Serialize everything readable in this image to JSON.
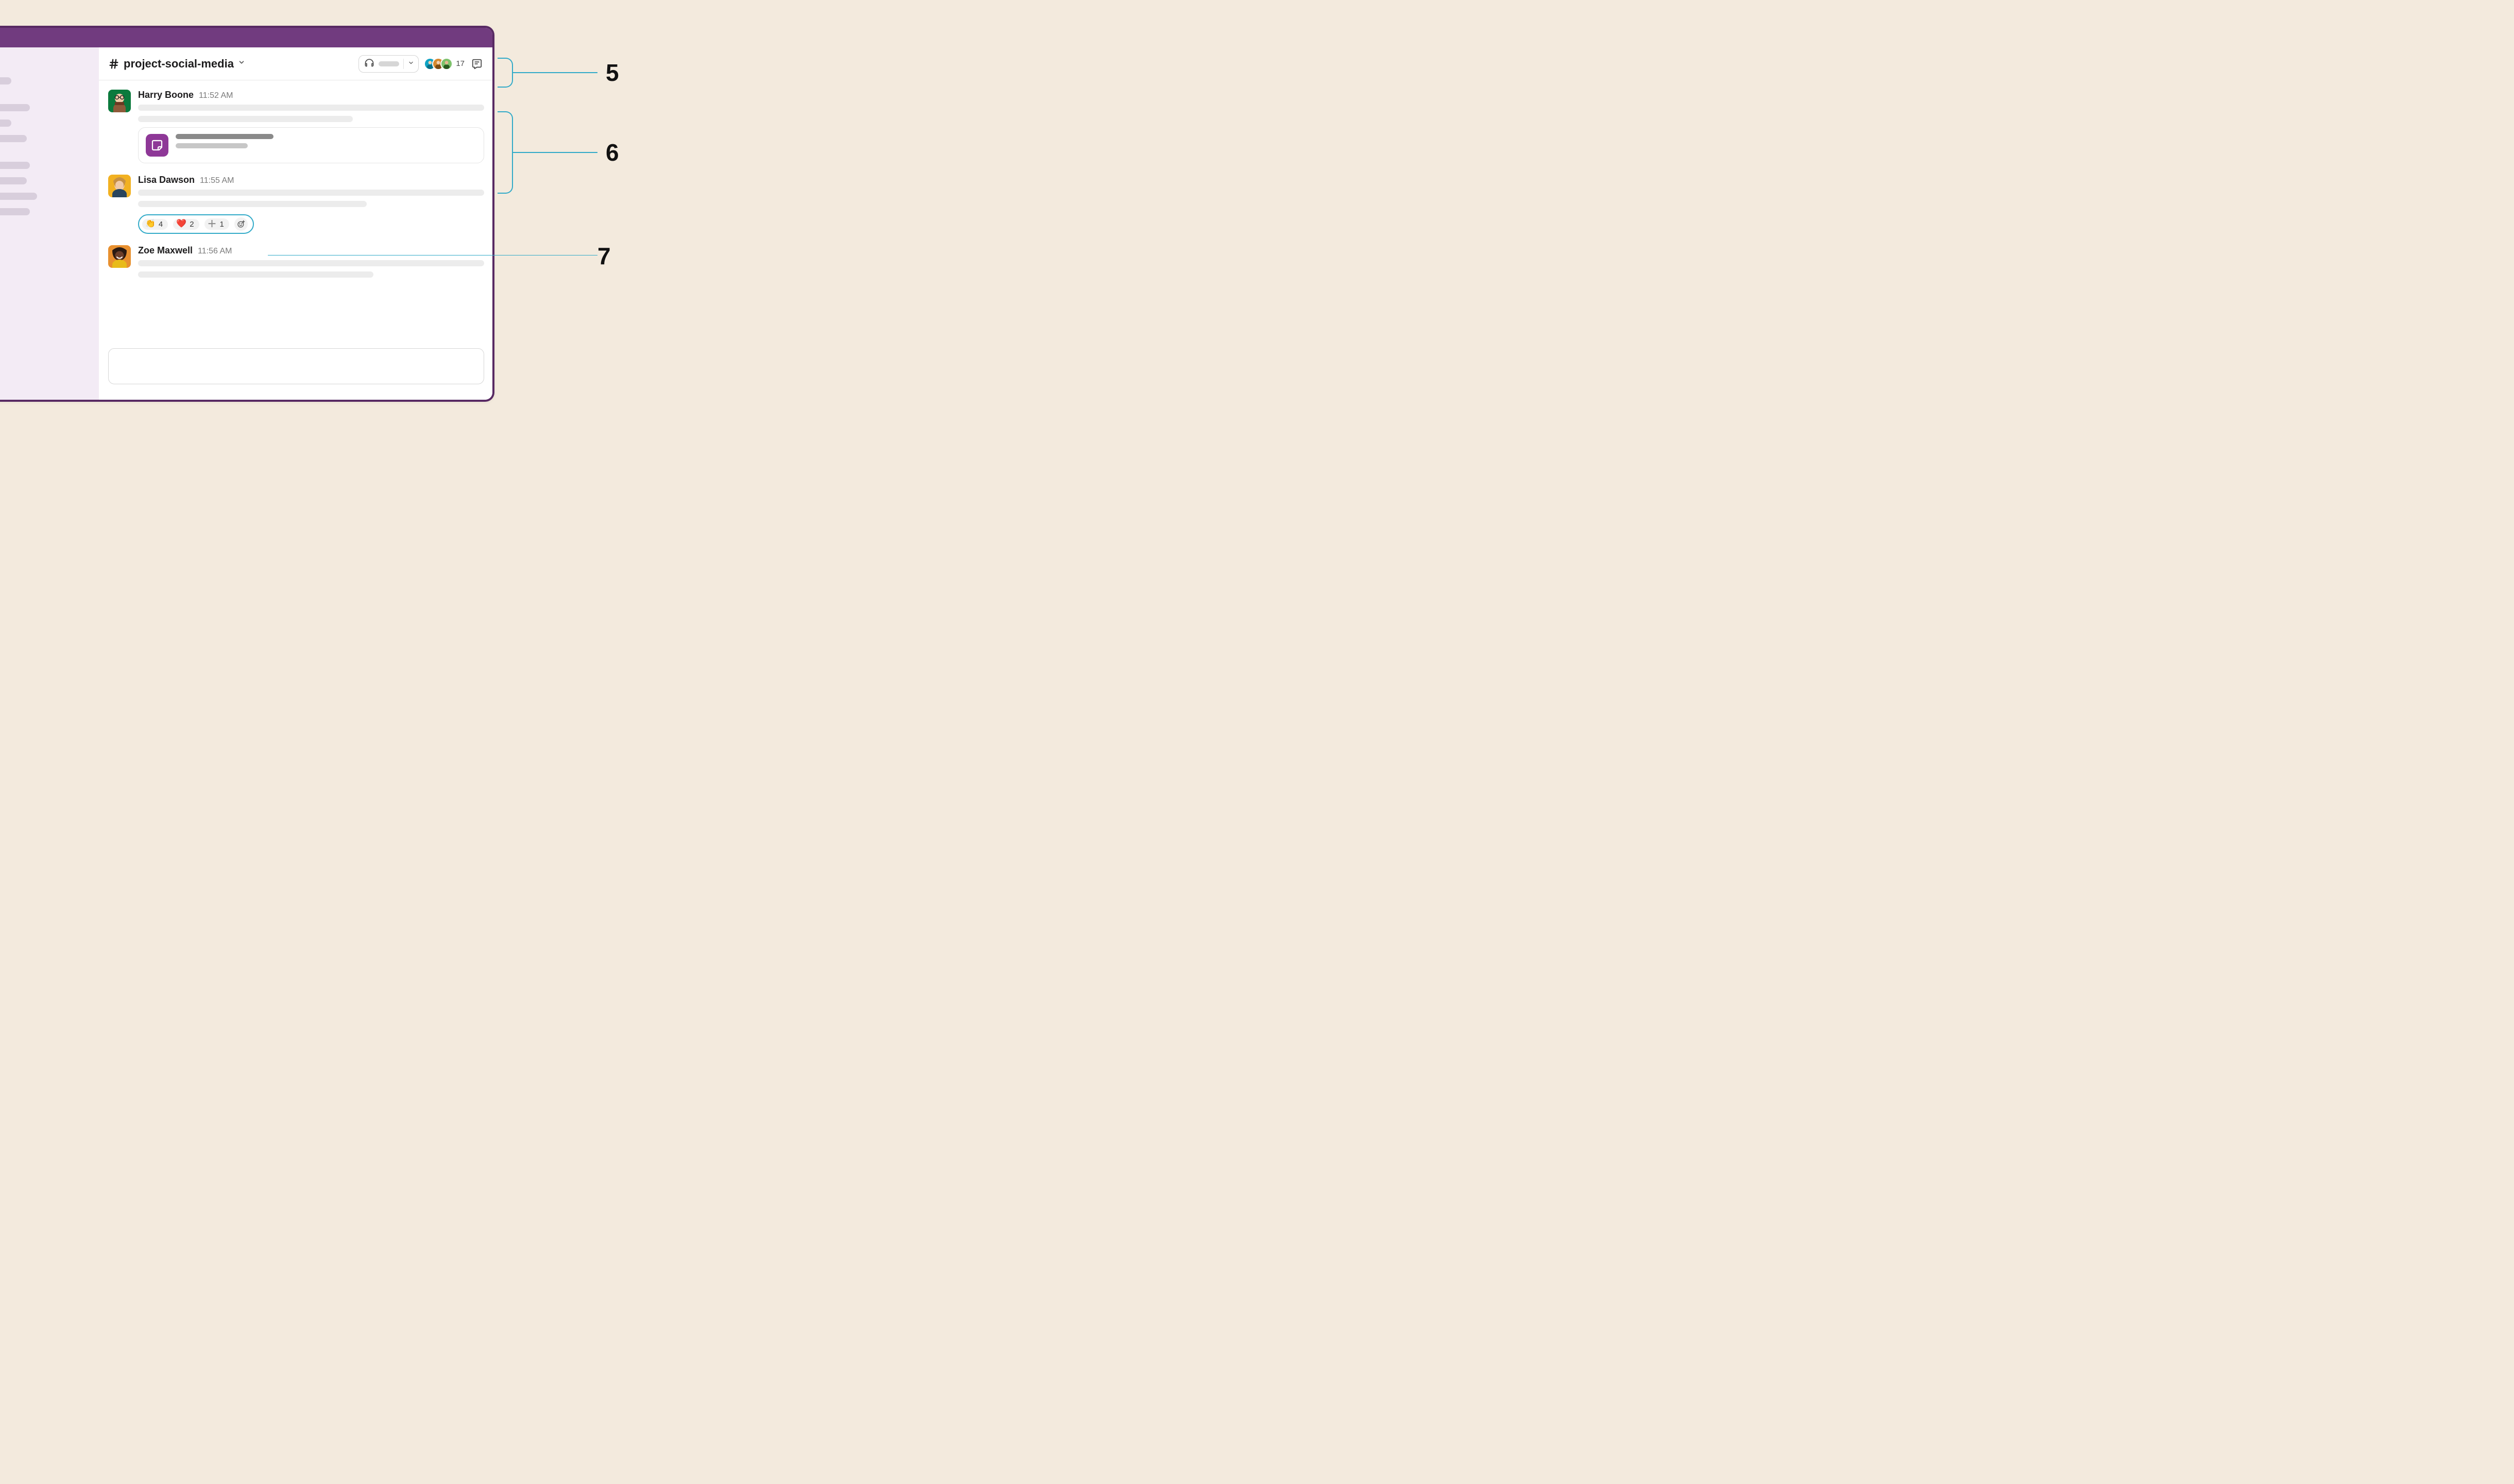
{
  "channel": {
    "name": "project-social-media",
    "member_count": "17"
  },
  "messages": [
    {
      "author": "Harry Boone",
      "timestamp": "11:52 AM"
    },
    {
      "author": "Lisa Dawson",
      "timestamp": "11:55 AM",
      "reactions": [
        {
          "emoji": "👏",
          "count": "4"
        },
        {
          "emoji": "❤️",
          "count": "2"
        },
        {
          "emoji": "＋",
          "count": "1"
        }
      ]
    },
    {
      "author": "Zoe Maxwell",
      "timestamp": "11:56 AM"
    }
  ],
  "annotations": {
    "header": "5",
    "message": "6",
    "reactions": "7"
  }
}
